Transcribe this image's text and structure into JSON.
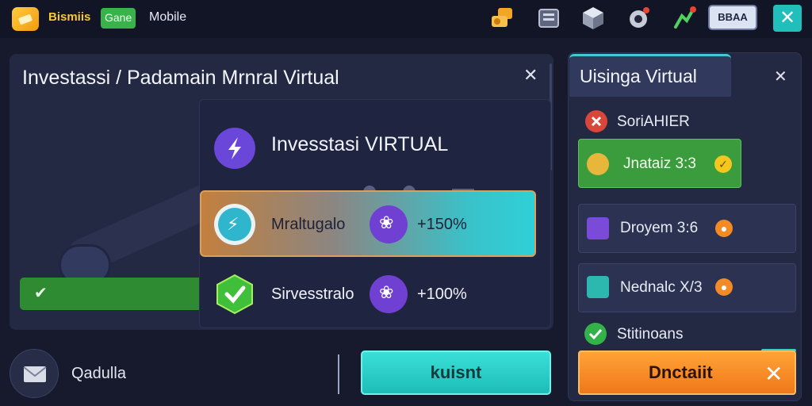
{
  "topbar": {
    "brand_name": "Bismiis",
    "brand_badge": "Gane",
    "brand_suffix": "Mobile",
    "action_label": "BBAA",
    "icons": [
      "coins-icon",
      "cards-icon",
      "cube-icon",
      "gear-icon",
      "chart-icon"
    ]
  },
  "left_panel": {
    "title": "Investassi / Padamain Mrnral Virtual",
    "card": {
      "title": "Invesstasi  VIRTUAL",
      "options": [
        {
          "label": "Mraltugalo",
          "value": "+150%",
          "selected": true
        },
        {
          "label": "Sirvesstralo",
          "value": "+100%",
          "selected": false
        }
      ]
    }
  },
  "bottom_bar": {
    "mail_label": "Qadulla",
    "main_action": "kuisnt"
  },
  "right_panel": {
    "title": "Uisinga Virtual",
    "items": [
      {
        "label": "SoriAHIER"
      },
      {
        "label": "Jnataiz 3:3"
      },
      {
        "label": "Droyem 3:6"
      },
      {
        "label": "Nednalc X/3"
      },
      {
        "label": "Stitinoans"
      }
    ],
    "cta_label": "Dnctaiit"
  },
  "colors": {
    "background": "#161a2c",
    "panel": "#232942",
    "accent_teal": "#2fd0d8",
    "accent_orange": "#f0781a",
    "accent_green": "#3a9c3c",
    "accent_purple": "#7040d3"
  }
}
